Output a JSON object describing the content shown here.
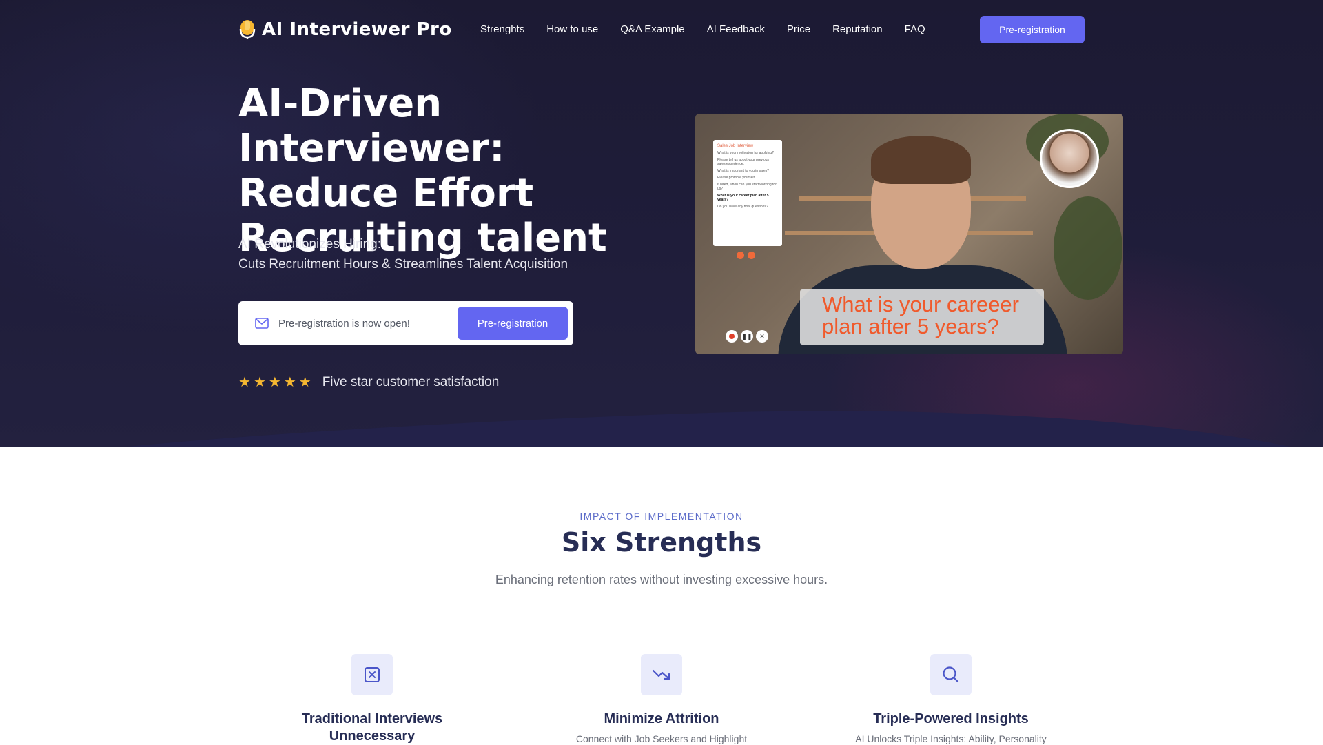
{
  "brand": {
    "name": "AI Interviewer Pro",
    "accent": "#6366f1",
    "icon": "microphone-logo-icon"
  },
  "nav": {
    "items": [
      "Strenghts",
      "How to use",
      "Q&A Example",
      "AI Feedback",
      "Price",
      "Reputation",
      "FAQ"
    ],
    "cta": "Pre-registration"
  },
  "hero": {
    "title_lines": [
      "AI-Driven Interviewer:",
      "Reduce Effort",
      "Recruiting talent"
    ],
    "subtitle_lines": [
      "AI Revolutionizes Hiring:",
      "Cuts Recruitment Hours & Streamlines Talent Acquisition"
    ],
    "signup": {
      "placeholder": "Pre-registration is now open!",
      "button": "Pre-registration",
      "icon": "mail-icon"
    },
    "rating": {
      "stars": 5,
      "text": "Five star customer satisfaction",
      "star_color": "#f5b731"
    }
  },
  "video": {
    "panel_title": "Sales Job Interview",
    "questions": [
      "What is your motivation for applying?",
      "Please tell us about your previous sales experience.",
      "What is important to you in sales?",
      "Please promote yourself.",
      "If hired, when can you start working for us?",
      "What is your career plan after 5 years?",
      "Do you have any final questions?"
    ],
    "caption_lines": [
      "What is your careeer",
      "plan after 5 years?"
    ]
  },
  "strengths": {
    "eyebrow": "IMPACT OF IMPLEMENTATION",
    "title": "Six Strengths",
    "subtitle": "Enhancing retention rates without investing excessive hours.",
    "cards": [
      {
        "icon": "x-square-icon",
        "title_lines": [
          "Traditional Interviews",
          "Unnecessary"
        ],
        "desc": ""
      },
      {
        "icon": "trending-down-icon",
        "title_lines": [
          "Minimize Attrition"
        ],
        "desc": "Connect with Job Seekers and Highlight"
      },
      {
        "icon": "search-icon",
        "title_lines": [
          "Triple-Powered Insights"
        ],
        "desc": "AI Unlocks Triple Insights: Ability, Personality"
      }
    ]
  }
}
